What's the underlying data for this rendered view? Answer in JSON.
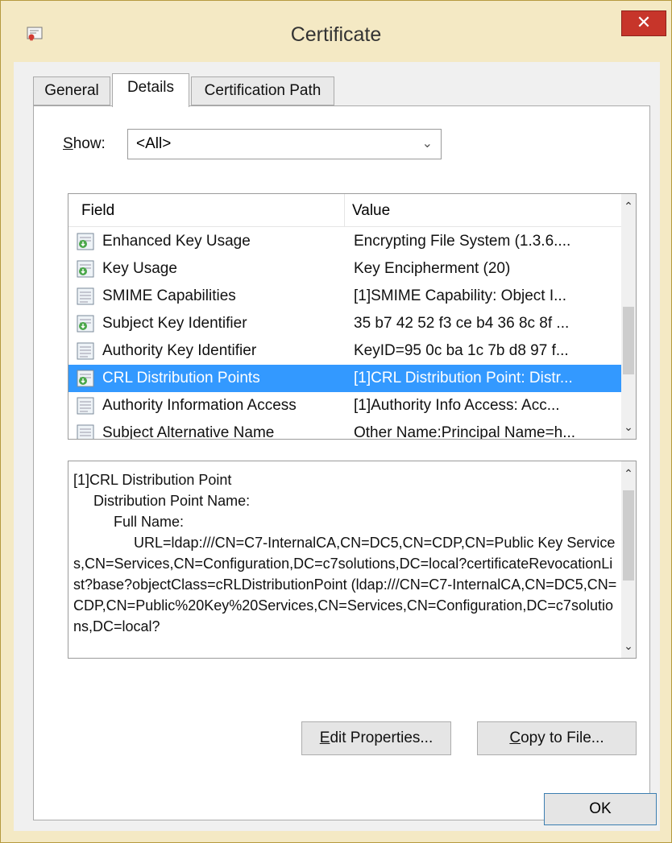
{
  "window": {
    "title": "Certificate",
    "close_label": "✕"
  },
  "tabs": [
    {
      "label": "General",
      "active": false
    },
    {
      "label": "Details",
      "active": true
    },
    {
      "label": "Certification Path",
      "active": false
    }
  ],
  "show": {
    "label_prefix": "S",
    "label_rest": "how:",
    "selected": "<All>"
  },
  "list": {
    "headers": {
      "field": "Field",
      "value": "Value"
    },
    "rows": [
      {
        "field": "Enhanced Key Usage",
        "value": "Encrypting File System (1.3.6...."
      },
      {
        "field": "Key Usage",
        "value": "Key Encipherment (20)"
      },
      {
        "field": "SMIME Capabilities",
        "value": "[1]SMIME Capability: Object I..."
      },
      {
        "field": "Subject Key Identifier",
        "value": "35 b7 42 52 f3 ce b4 36 8c 8f ..."
      },
      {
        "field": "Authority Key Identifier",
        "value": "KeyID=95 0c ba 1c 7b d8 97 f..."
      },
      {
        "field": "CRL Distribution Points",
        "value": "[1]CRL Distribution Point: Distr..."
      },
      {
        "field": "Authority Information Access",
        "value": "[1]Authority Info Access: Acc..."
      },
      {
        "field": "Subject Alternative Name",
        "value": "Other Name:Principal Name=h..."
      }
    ],
    "selected_index": 5
  },
  "detail": {
    "text": "[1]CRL Distribution Point\n     Distribution Point Name:\n          Full Name:\n               URL=ldap:///CN=C7-InternalCA,CN=DC5,CN=CDP,CN=Public Key Services,CN=Services,CN=Configuration,DC=c7solutions,DC=local?certificateRevocationList?base?objectClass=cRLDistributionPoint (ldap:///CN=C7-InternalCA,CN=DC5,CN=CDP,CN=Public%20Key%20Services,CN=Services,CN=Configuration,DC=c7solutions,DC=local?"
  },
  "buttons": {
    "edit_prefix": "E",
    "edit_rest": "dit Properties...",
    "copy_prefix": "C",
    "copy_rest": "opy to File...",
    "ok": "OK"
  },
  "icons": {
    "app": "certificate-icon",
    "row": "certificate-field-icon",
    "scroll_up": "chevron-up-icon",
    "scroll_down": "chevron-down-icon",
    "dropdown": "chevron-down-icon"
  },
  "colors": {
    "frame": "#f4e9c4",
    "close": "#c7352a",
    "selection": "#3399ff"
  }
}
